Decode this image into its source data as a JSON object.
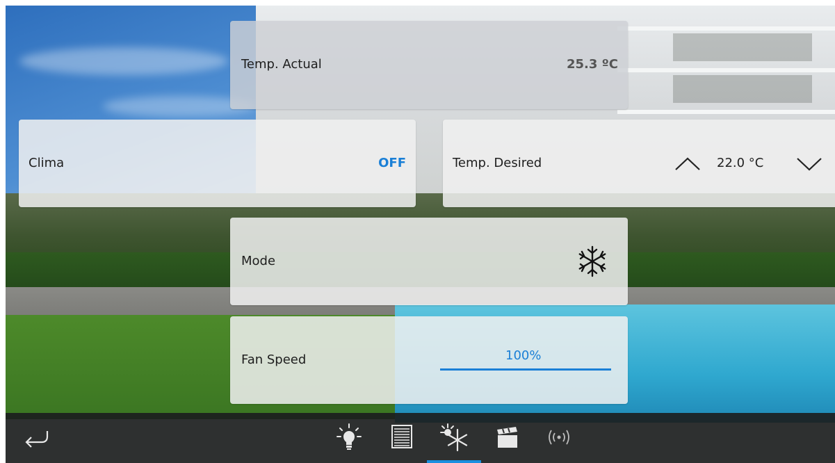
{
  "temp_actual": {
    "label": "Temp. Actual",
    "value": "25.3 ºC"
  },
  "clima": {
    "label": "Clima",
    "state": "OFF",
    "state_color": "#1a7fd6"
  },
  "temp_desired": {
    "label": "Temp. Desired",
    "value": "22.0 °C",
    "increase_icon": "chevron-up-icon",
    "decrease_icon": "chevron-down-icon"
  },
  "mode": {
    "label": "Mode",
    "icon": "snowflake-icon"
  },
  "fan_speed": {
    "label": "Fan Speed",
    "value": "100%",
    "level": 1.0,
    "accent": "#1a7fd6"
  },
  "navbar": {
    "back_icon": "back-arrow-icon",
    "items": [
      {
        "icon": "lightbulb-icon"
      },
      {
        "icon": "blinds-icon"
      },
      {
        "icon": "climate-icon",
        "active": true
      },
      {
        "icon": "scene-clapper-icon"
      },
      {
        "icon": "wireless-signal-icon"
      }
    ],
    "active_color": "#1a8fe0"
  }
}
